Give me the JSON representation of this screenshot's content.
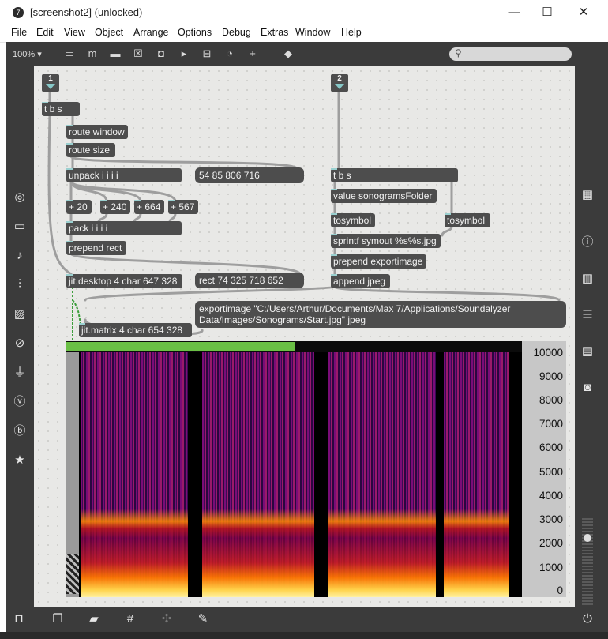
{
  "window": {
    "title": "[screenshot2] (unlocked)",
    "app_icon": "7"
  },
  "window_controls": {
    "minimize": "—",
    "maximize": "☐",
    "close": "✕"
  },
  "menubar": [
    "File",
    "Edit",
    "View",
    "Object",
    "Arrange",
    "Options",
    "Debug",
    "Extras",
    "Window",
    "Help"
  ],
  "toolbar": {
    "zoom": "100%",
    "icons": [
      "presentation-icon",
      "comment-icon",
      "speech-icon",
      "box-x-icon",
      "target-icon",
      "play-icon",
      "minus-box-icon",
      "dial-icon",
      "plus-icon",
      "paint-bucket-icon"
    ],
    "search_placeholder": ""
  },
  "left_sidebar": [
    "target-icon",
    "keyboard-icon",
    "music-note-icon",
    "sequencer-icon",
    "image-icon",
    "paperclip-icon",
    "plug-icon",
    "v-icon",
    "b-icon",
    "star-icon"
  ],
  "right_sidebar": [
    "grid-icon",
    "info-icon",
    "book-icon",
    "list-icon",
    "reference-icon",
    "camera-icon"
  ],
  "bottom_bar": [
    "lock-icon",
    "windows-icon",
    "presentation-icon",
    "grid-icon",
    "debug-icon",
    "wrench-icon",
    "power-icon"
  ],
  "patch": {
    "inlets": [
      "1",
      "2"
    ],
    "objects": {
      "tbs1": "t b s",
      "route_window": "route window",
      "route_size": "route size",
      "unpack": "unpack i i i i",
      "add20": "+ 20",
      "add240": "+ 240",
      "add664": "+ 664",
      "add567": "+ 567",
      "pack": "pack i i i i",
      "prepend_rect": "prepend rect",
      "jit_desktop": "jit.desktop 4 char 647 328",
      "jit_matrix": "jit.matrix 4 char 654 328",
      "tbs2": "t b s",
      "value_folder": "value sonogramsFolder",
      "tosymbol1": "tosymbol",
      "tosymbol2": "tosymbol",
      "sprintf": "sprintf symout %s%s.jpg",
      "prepend_export": "prepend exportimage",
      "append_jpeg": "append jpeg"
    },
    "messages": {
      "numbers": "54 85 806 716",
      "rect": "rect 74 325 718 652",
      "exportimage": "exportimage \"C:/Users/Arthur/Documents/Max 7/Applications/Soundalyzer Data/Images/Sonograms/Start.jpg\" jpeg"
    }
  },
  "spectrogram": {
    "progress_fraction": 0.5,
    "progress_color": "#6abf45",
    "y_ticks": [
      "10000",
      "9000",
      "8000",
      "7000",
      "6000",
      "5000",
      "4000",
      "3000",
      "2000",
      "1000",
      "0"
    ]
  }
}
